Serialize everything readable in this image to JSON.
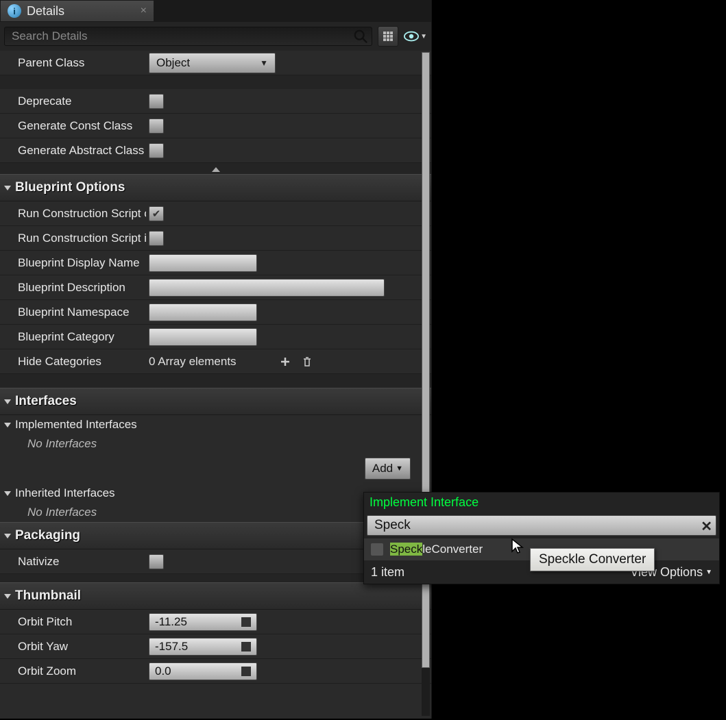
{
  "tab": {
    "title": "Details"
  },
  "search": {
    "placeholder": "Search Details"
  },
  "parentClass": {
    "label": "Parent Class",
    "value": "Object"
  },
  "flags": {
    "deprecate": "Deprecate",
    "genConst": "Generate Const Class",
    "genAbstract": "Generate Abstract Class"
  },
  "sections": {
    "blueprint": "Blueprint Options",
    "interfaces": "Interfaces",
    "packaging": "Packaging",
    "thumbnail": "Thumbnail"
  },
  "bp": {
    "runConstrDrag": "Run Construction Script on",
    "runConstrSeq": "Run Construction Script in",
    "displayName": "Blueprint Display Name",
    "description": "Blueprint Description",
    "namespace": "Blueprint Namespace",
    "category": "Blueprint Category",
    "hideCategories": "Hide Categories",
    "arrayText": "0 Array elements"
  },
  "interfaces": {
    "implemented": "Implemented Interfaces",
    "inherited": "Inherited Interfaces",
    "none": "No Interfaces",
    "addBtn": "Add"
  },
  "packaging": {
    "nativize": "Nativize"
  },
  "thumbnail": {
    "orbitPitch": {
      "label": "Orbit Pitch",
      "value": "-11.25"
    },
    "orbitYaw": {
      "label": "Orbit Yaw",
      "value": "-157.5"
    },
    "orbitZoom": {
      "label": "Orbit Zoom",
      "value": "0.0"
    }
  },
  "popup": {
    "title": "Implement Interface",
    "searchValue": "Speck",
    "resultHighlight": "Speck",
    "resultRest": "leConverter",
    "count": "1 item",
    "viewOptions": "View Options"
  },
  "tooltip": "Speckle Converter"
}
